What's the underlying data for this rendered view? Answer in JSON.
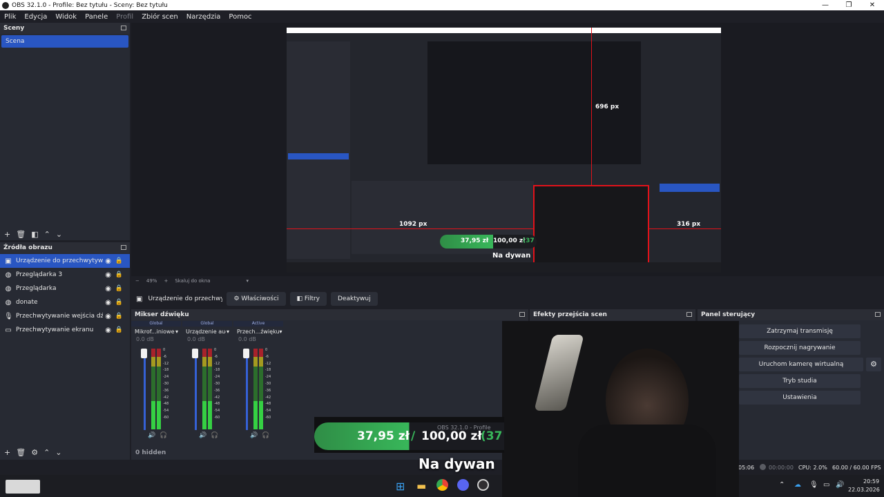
{
  "window": {
    "title": "OBS 32.1.0 - Profile: Bez tytułu - Sceny: Bez tytułu"
  },
  "menu": [
    "Plik",
    "Edycja",
    "Widok",
    "Panele",
    "Profil",
    "Zbiór scen",
    "Narzędzia",
    "Pomoc"
  ],
  "scenes": {
    "title": "Sceny",
    "items": [
      "Scena"
    ]
  },
  "sources": {
    "title": "Źródła obrazu",
    "items": [
      {
        "icon": "camera-icon",
        "label": "Urządzenie do przechwytywania"
      },
      {
        "icon": "globe-icon",
        "label": "Przeglądarka 3"
      },
      {
        "icon": "globe-icon",
        "label": "Przeglądarka"
      },
      {
        "icon": "globe-icon",
        "label": "donate"
      },
      {
        "icon": "microphone-icon",
        "label": "Przechwytywanie wejścia dźwięku"
      },
      {
        "icon": "monitor-icon",
        "label": "Przechwytywanie ekranu"
      }
    ]
  },
  "preview": {
    "measure_top": "696 px",
    "measure_left": "1092 px",
    "measure_right": "316 px",
    "zoom": "49%",
    "scale_label": "Skaluj do okna",
    "inner_donation_current": "37,95 zł",
    "inner_donation_goal": "100,00 zł",
    "inner_donation_pct": "(37",
    "inner_subtitle": "Na dywan"
  },
  "source_toolbar": {
    "selected": "Urządzenie do przechwytywania",
    "properties": "Właściwości",
    "filters": "Filtry",
    "deactivate": "Deaktywuj"
  },
  "mixer": {
    "title": "Mikser dźwięku",
    "hidden": "0 hidden",
    "scale": [
      "0",
      "-6",
      "-12",
      "-18",
      "-24",
      "-30",
      "-36",
      "-42",
      "-48",
      "-54",
      "-60"
    ],
    "channels": [
      {
        "badge": "Global",
        "name": "Mikrof...iniowe",
        "db": "0.0 dB"
      },
      {
        "badge": "Global",
        "name": "Urządzenie audio",
        "db": "0.0 dB"
      },
      {
        "badge": "Active",
        "name": "Przech...źwięku",
        "db": "0.0 dB"
      }
    ]
  },
  "transitions": {
    "title": "Efekty przejścia scen"
  },
  "controls": {
    "title": "Panel sterujący",
    "stop_stream": "Zatrzymaj transmisję",
    "start_record": "Rozpocznij nagrywanie",
    "virtual_cam": "Uruchom kamerę wirtualną",
    "studio": "Tryb studia",
    "settings": "Ustawienia"
  },
  "overlay": {
    "donation_current": "37,95 zł",
    "donation_sep": "/",
    "donation_goal": "100,00 zł",
    "donation_pct": "(37",
    "subtitle": "Na dywan",
    "ghost_title": "OBS 32.1.0 - Profile"
  },
  "status": {
    "stream_time": "05:06",
    "rec_time": "00:00:00",
    "cpu": "CPU: 2.0%",
    "fps": "60.00 / 60.00 FPS"
  },
  "clock": {
    "time": "20:59",
    "date": "22.03.2026"
  },
  "colors": {
    "accent": "#2956c2",
    "live": "#e2121a",
    "meter_green": "#35d043",
    "donation": "#38b75a"
  }
}
